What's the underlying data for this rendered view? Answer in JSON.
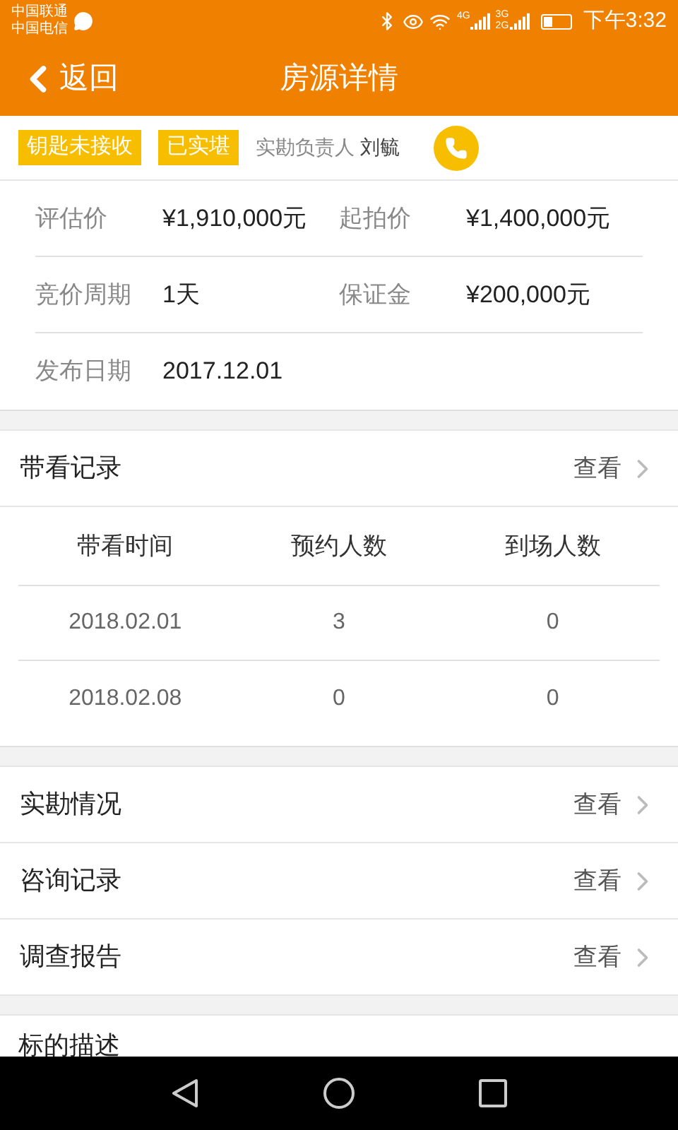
{
  "status_bar": {
    "carriers": [
      "中国联通",
      "中国电信"
    ],
    "network_1": "4G",
    "network_2": "3G 2G",
    "time": "下午3:32"
  },
  "header": {
    "back": "返回",
    "title": "房源详情"
  },
  "tags": [
    "钥匙未接收",
    "已实堪"
  ],
  "inspector": {
    "label": "实勘负责人",
    "name": "刘毓"
  },
  "info": [
    [
      {
        "label": "评估价",
        "value": "¥1,910,000元"
      },
      {
        "label": "起拍价",
        "value": "¥1,400,000元"
      }
    ],
    [
      {
        "label": "竞价周期",
        "value": "1天"
      },
      {
        "label": "保证金",
        "value": "¥200,000元"
      }
    ],
    [
      {
        "label": "发布日期",
        "value": "2017.12.01"
      }
    ]
  ],
  "viewing": {
    "title": "带看记录",
    "action": "查看",
    "columns": [
      "带看时间",
      "预约人数",
      "到场人数"
    ],
    "rows": [
      [
        "2018.02.01",
        "3",
        "0"
      ],
      [
        "2018.02.08",
        "0",
        "0"
      ]
    ]
  },
  "links": [
    {
      "title": "实勘情况",
      "action": "查看"
    },
    {
      "title": "咨询记录",
      "action": "查看"
    },
    {
      "title": "调查报告",
      "action": "查看"
    }
  ],
  "description": {
    "title": "标的描述"
  }
}
